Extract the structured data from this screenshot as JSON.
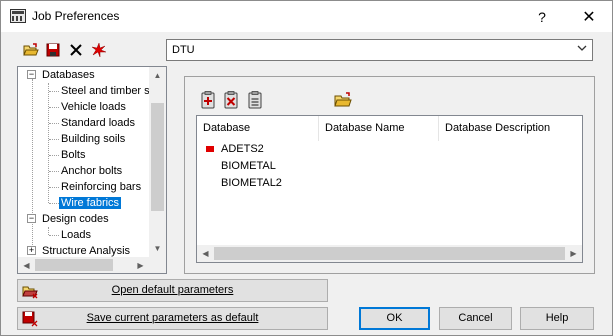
{
  "window": {
    "title": "Job Preferences",
    "help_glyph": "?",
    "close_glyph": "✕"
  },
  "toolbar": {
    "icons": [
      "open-folder-icon",
      "save-icon",
      "delete-icon",
      "reset-icon"
    ]
  },
  "database_select": {
    "value": "DTU"
  },
  "tree": {
    "items": [
      {
        "label": "Databases",
        "level": 0,
        "expander": "−"
      },
      {
        "label": "Steel and timber s",
        "level": 1
      },
      {
        "label": "Vehicle loads",
        "level": 1
      },
      {
        "label": "Standard loads",
        "level": 1
      },
      {
        "label": "Building soils",
        "level": 1
      },
      {
        "label": "Bolts",
        "level": 1
      },
      {
        "label": "Anchor bolts",
        "level": 1
      },
      {
        "label": "Reinforcing bars",
        "level": 1
      },
      {
        "label": "Wire fabrics",
        "level": 1,
        "selected": true
      },
      {
        "label": "Design codes",
        "level": 0,
        "expander": "−"
      },
      {
        "label": "Loads",
        "level": 1
      },
      {
        "label": "Structure Analysis",
        "level": 0,
        "expander": "+"
      }
    ]
  },
  "panel": {
    "icons": [
      "add-database-icon",
      "remove-database-icon",
      "database-properties-icon",
      "open-database-folder-icon"
    ],
    "columns": [
      "Database",
      "Database Name",
      "Database Description"
    ],
    "rows": [
      {
        "database": "ADETS2",
        "active": true
      },
      {
        "database": "BIOMETAL",
        "active": false
      },
      {
        "database": "BIOMETAL2",
        "active": false
      }
    ],
    "active_marker_color": "#e00000"
  },
  "buttons": {
    "open_default": "Open default parameters",
    "save_default": "Save current parameters as default",
    "ok": "OK",
    "cancel": "Cancel",
    "help": "Help"
  },
  "scroll_glyphs": {
    "up": "▲",
    "down": "▼",
    "left": "◀",
    "right": "▶",
    "dropdown": "⌵"
  }
}
